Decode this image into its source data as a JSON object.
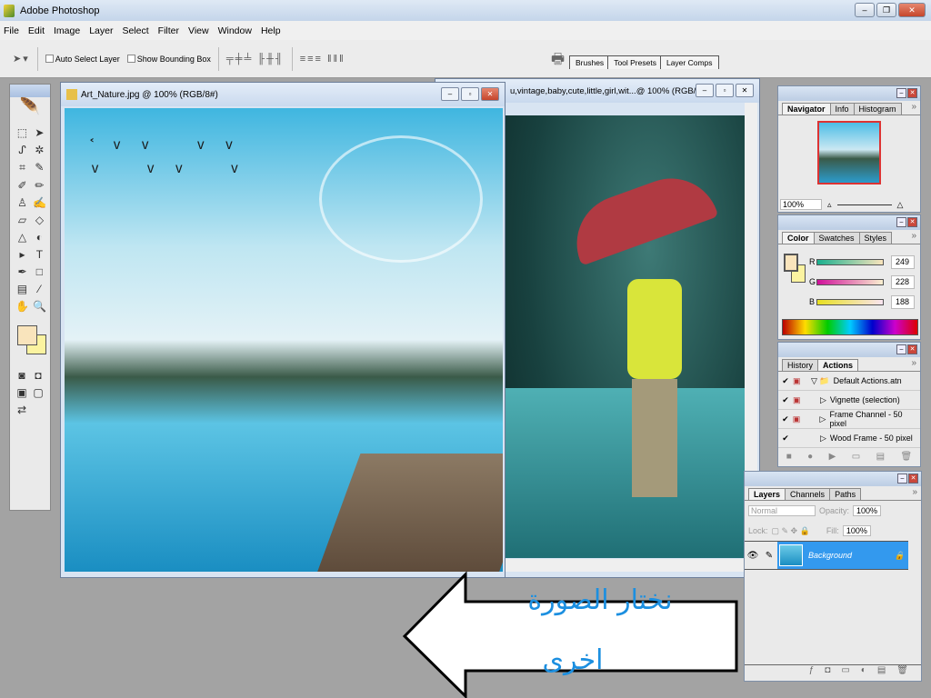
{
  "app": {
    "title": "Adobe Photoshop"
  },
  "menu": [
    "File",
    "Edit",
    "Image",
    "Layer",
    "Select",
    "Filter",
    "View",
    "Window",
    "Help"
  ],
  "options": {
    "auto_select_layer": "Auto Select Layer",
    "show_bounding_box": "Show Bounding Box"
  },
  "palette_well": [
    "Brushes",
    "Tool Presets",
    "Layer Comps"
  ],
  "doc1": {
    "title": "Art_Nature.jpg @ 100% (RGB/8#)"
  },
  "doc2": {
    "title": "u,vintage,baby,cute,little,girl,wit...@ 100% (RGB/..."
  },
  "navigator": {
    "tabs": [
      "Navigator",
      "Info",
      "Histogram"
    ],
    "zoom": "100%"
  },
  "color": {
    "tabs": [
      "Color",
      "Swatches",
      "Styles"
    ],
    "r_label": "R",
    "g_label": "G",
    "b_label": "B",
    "r": "249",
    "g": "228",
    "b": "188",
    "fg": "#f9e4bc",
    "bg": "#fbf3a0"
  },
  "actions": {
    "tabs": [
      "History",
      "Actions"
    ],
    "items": [
      "Default Actions.atn",
      "Vignette (selection)",
      "Frame Channel - 50 pixel",
      "Wood Frame - 50 pixel"
    ]
  },
  "layers": {
    "tabs": [
      "Layers",
      "Channels",
      "Paths"
    ],
    "blend": "Normal",
    "opacity_label": "Opacity:",
    "opacity": "100%",
    "lock_label": "Lock:",
    "fill_label": "Fill:",
    "fill": "100%",
    "layer_name": "Background"
  },
  "annotation": {
    "line1": "نختار الصورة",
    "line2": "اخرى"
  }
}
